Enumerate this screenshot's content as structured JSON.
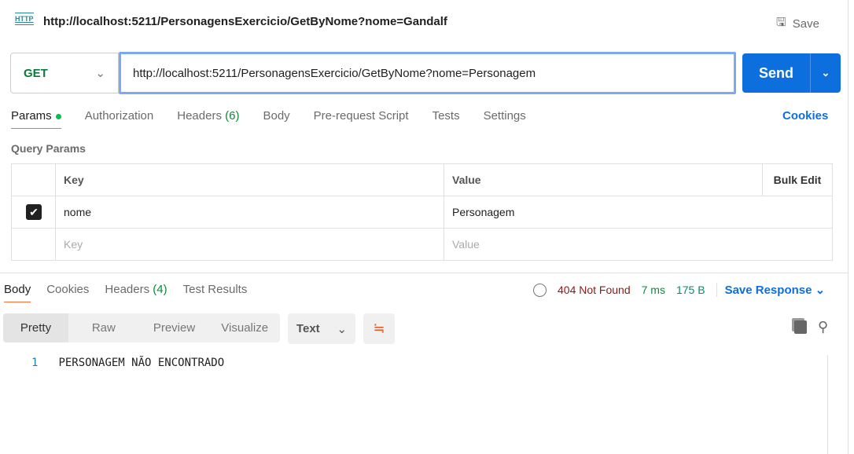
{
  "header": {
    "icon_label": "HTTP",
    "title": "http://localhost:5211/PersonagensExercicio/GetByNome?nome=Gandalf",
    "save_label": "Save"
  },
  "request": {
    "method": "GET",
    "url": "http://localhost:5211/PersonagensExercicio/GetByNome?nome=Personagem",
    "send_label": "Send"
  },
  "tabs": [
    {
      "label": "Params"
    },
    {
      "label": "Authorization"
    },
    {
      "label": "Headers",
      "count": "(6)"
    },
    {
      "label": "Body"
    },
    {
      "label": "Pre-request Script"
    },
    {
      "label": "Tests"
    },
    {
      "label": "Settings"
    }
  ],
  "cookies_label": "Cookies",
  "query_params": {
    "title": "Query Params",
    "columns": {
      "key": "Key",
      "value": "Value",
      "bulk": "Bulk Edit"
    },
    "rows": [
      {
        "checked": true,
        "key": "nome",
        "value": "Personagem"
      }
    ],
    "placeholder": {
      "key": "Key",
      "value": "Value"
    }
  },
  "response": {
    "tabs": [
      {
        "label": "Body"
      },
      {
        "label": "Cookies"
      },
      {
        "label": "Headers",
        "count": "(4)"
      },
      {
        "label": "Test Results"
      }
    ],
    "status": "404 Not Found",
    "time": "7 ms",
    "size": "175 B",
    "save_response": "Save Response",
    "views": [
      "Pretty",
      "Raw",
      "Preview",
      "Visualize"
    ],
    "format": "Text",
    "lines": [
      {
        "n": "1",
        "text": "PERSONAGEM NÃO ENCONTRADO"
      }
    ]
  },
  "colors": {
    "accent": "#0d6fde",
    "method": "#0b7a3b",
    "status_error": "#8b1a1a",
    "active_tab": "#ff6c37"
  }
}
